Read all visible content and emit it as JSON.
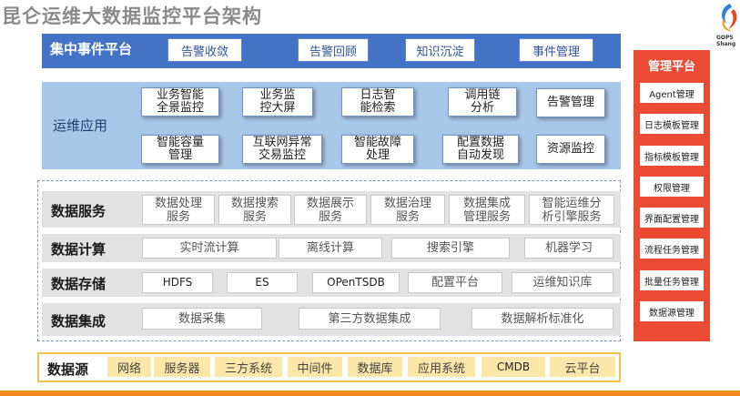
{
  "title": "昆仑运维大数据监控平台架构",
  "logo": {
    "icon": "gops-logo-icon",
    "text_line1": "GOPS",
    "text_line2": "Shang"
  },
  "event_platform": {
    "title": "集中事件平台",
    "buttons": [
      "告警收敛",
      "告警回顾",
      "知识沉淀",
      "事件管理"
    ]
  },
  "ops_apps": {
    "title": "运维应用",
    "items": [
      "业务智能\n全景监控",
      "业务监\n控大屏",
      "日志智\n能检索",
      "调用链\n分析",
      "告警管理",
      "智能容量\n管理",
      "互联网异常\n交易监控",
      "智能故障\n处理",
      "配置数据\n自动发现",
      "资源监控"
    ]
  },
  "data_service": {
    "title": "数据服务",
    "items": [
      "数据处理\n服务",
      "数据搜索\n服务",
      "数据展示\n服务",
      "数据治理\n服务",
      "数据集成\n管理服务",
      "智能运维分\n析引擎服务"
    ]
  },
  "data_compute": {
    "title": "数据计算",
    "items": [
      "实时流计算",
      "离线计算",
      "搜索引擎",
      "机器学习"
    ]
  },
  "data_storage": {
    "title": "数据存储",
    "items": [
      "HDFS",
      "ES",
      "OPenTSDB",
      "配置平台",
      "运维知识库"
    ]
  },
  "data_integration": {
    "title": "数据集成",
    "items": [
      "数据采集",
      "第三方数据集成",
      "数据解析标准化"
    ]
  },
  "data_source": {
    "title": "数据源",
    "items": [
      "网络",
      "服务器",
      "三方系统",
      "中间件",
      "数据库",
      "应用系统",
      "CMDB",
      "云平台"
    ]
  },
  "management": {
    "title": "管理平台",
    "items": [
      "Agent管理",
      "日志模板管理",
      "指标模板管理",
      "权限管理",
      "界面配置管理",
      "流程任务管理",
      "批量任务管理",
      "数据源管理"
    ]
  },
  "colors": {
    "event_bar": "#4472c4",
    "ops_panel": "#a9c7e8",
    "layer_bg": "#e2e2e2",
    "source_fill": "#fbe7a8",
    "source_border": "#f2c14e",
    "management": "#e94b35",
    "bottom_line": "#f28a1e"
  }
}
